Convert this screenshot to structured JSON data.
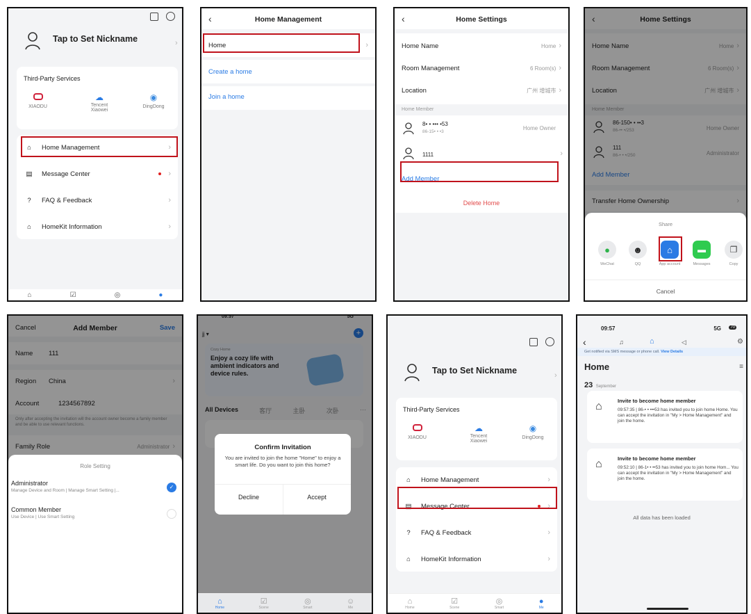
{
  "profile": {
    "nickname": "Tap to Set Nickname",
    "third_party_title": "Third-Party Services",
    "services": [
      "XIAODU",
      "Tencent\nXiaowei",
      "DingDong"
    ],
    "menu": [
      "Home Management",
      "Message Center",
      "FAQ & Feedback",
      "HomeKit Information"
    ]
  },
  "home_management": {
    "title": "Home Management",
    "items": [
      "Home",
      "Create a home",
      "Join a home"
    ]
  },
  "home_settings": {
    "title": "Home Settings",
    "rows": [
      {
        "label": "Home Name",
        "value": "Home"
      },
      {
        "label": "Room Management",
        "value": "6 Room(s)"
      },
      {
        "label": "Location",
        "value": "广州 增城市"
      }
    ],
    "member_header": "Home Member",
    "members": [
      {
        "name": "8• • ••• •53",
        "sub": "86-15• • •3",
        "role": "Home Owner"
      },
      {
        "name": "1111",
        "sub": "",
        "role": ""
      }
    ],
    "add_member": "Add Member",
    "delete_home": "Delete Home"
  },
  "share_screen": {
    "title": "Home Settings",
    "rows": [
      {
        "label": "Home Name",
        "value": "Home"
      },
      {
        "label": "Room Management",
        "value": "6 Room(s)"
      },
      {
        "label": "Location",
        "value": "广州 增城市"
      }
    ],
    "member_header": "Home Member",
    "members": [
      {
        "name": "86-150• • ••3",
        "sub": "86-•• •/253",
        "role": "Home Owner"
      },
      {
        "name": "111",
        "sub": "86-• • •/250",
        "role": "Administrator"
      }
    ],
    "add_member": "Add Member",
    "transfer": "Transfer Home Ownership",
    "share_title": "Share",
    "share_targets": [
      "WeChat",
      "QQ",
      "App account",
      "Messages",
      "Copy"
    ],
    "cancel": "Cancel"
  },
  "add_member": {
    "cancel": "Cancel",
    "title": "Add Member",
    "save": "Save",
    "name_label": "Name",
    "name_value": "111",
    "region_label": "Region",
    "region_value": "China",
    "account_label": "Account",
    "account_value": "1234567892",
    "note": "Only after accepting the invitation will the account owner become a family member and be able to use relevant functions.",
    "family_role_label": "Family Role",
    "family_role_value": "Administrator",
    "role_sheet_title": "Role Setting",
    "roles": [
      {
        "name": "Administrator",
        "desc": "Manage Device and Room | Manage Smart Setting |..."
      },
      {
        "name": "Common Member",
        "desc": "Use Device | Use Smart Setting"
      }
    ]
  },
  "invite": {
    "status_time": "09:57",
    "status_right": "5G",
    "home_name": "jj",
    "banner_tag": "Cozy Home",
    "banner_text": "Enjoy a cozy life with ambient indicators and device rules.",
    "tabs": [
      "All Devices",
      "客厅",
      "主卧",
      "次卧",
      "···"
    ],
    "dialog_title": "Confirm Invitation",
    "dialog_body": "You are invited to join the home \"Home\" to enjoy a smart life. Do you want to join this home?",
    "decline": "Decline",
    "accept": "Accept",
    "tabbar": [
      "Home",
      "Scene",
      "Smart",
      "Me"
    ]
  },
  "profile2": {
    "nickname": "Tap to Set Nickname",
    "third_party_title": "Third-Party Services",
    "services": [
      "XIAODU",
      "Tencent\nXiaowei",
      "DingDong"
    ],
    "menu": [
      "Home Management",
      "Message Center",
      "FAQ & Feedback",
      "HomeKit Information"
    ],
    "tabbar": [
      "Home",
      "Scene",
      "Smart",
      "Me"
    ]
  },
  "messages": {
    "status_time": "09:57",
    "status_right": "5G",
    "battery": "70",
    "notify_bar": "Get notified via SMS message or phone call.",
    "notify_link": "View Details",
    "title": "Home",
    "date_day": "23",
    "date_month": "September",
    "items": [
      {
        "title": "Invite to become home member",
        "body": "09:57:35 | 86-• • •••53 has invited you to join home Home. You can accept the invitation in \"My > Home Management\" and join the home."
      },
      {
        "title": "Invite to become home member",
        "body": "09:52:10 | 86-1• • ••53 has invited you to join home Hom... You can accept the invitation in \"My > Home Management\" and join the home."
      }
    ],
    "footer": "All data has been loaded"
  },
  "colors": {
    "accent": "#2a7be4",
    "highlight": "#c0121b",
    "danger": "#e24b4b"
  }
}
